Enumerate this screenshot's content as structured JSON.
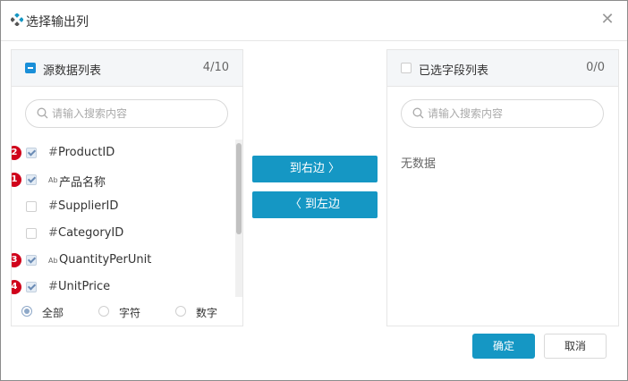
{
  "dialog": {
    "title": "选择输出列",
    "close_icon": "close-icon",
    "accent_color": "#1597c4",
    "badge_color": "#d0021b"
  },
  "source_panel": {
    "title": "源数据列表",
    "count": "4/10",
    "select_state": "partial",
    "search_placeholder": "请输入搜索内容",
    "fields": [
      {
        "badge": "2",
        "checked": true,
        "type": "number",
        "type_symbol": "#",
        "name": "ProductID"
      },
      {
        "badge": "1",
        "checked": true,
        "type": "text",
        "type_symbol": "Ab",
        "name": "产品名称"
      },
      {
        "badge": "",
        "checked": false,
        "type": "number",
        "type_symbol": "#",
        "name": "SupplierID"
      },
      {
        "badge": "",
        "checked": false,
        "type": "number",
        "type_symbol": "#",
        "name": "CategoryID"
      },
      {
        "badge": "3",
        "checked": true,
        "type": "text",
        "type_symbol": "Ab",
        "name": "QuantityPerUnit"
      },
      {
        "badge": "4",
        "checked": true,
        "type": "number",
        "type_symbol": "#",
        "name": "UnitPrice"
      }
    ],
    "filters": [
      {
        "label": "全部",
        "selected": true
      },
      {
        "label": "字符",
        "selected": false
      },
      {
        "label": "数字",
        "selected": false
      }
    ]
  },
  "target_panel": {
    "title": "已选字段列表",
    "count": "0/0",
    "search_placeholder": "请输入搜索内容",
    "empty_text": "无数据"
  },
  "transfer": {
    "to_right_label": "到右边 〉",
    "to_left_label": "〈 到左边"
  },
  "footer": {
    "confirm_label": "确定",
    "cancel_label": "取消"
  }
}
